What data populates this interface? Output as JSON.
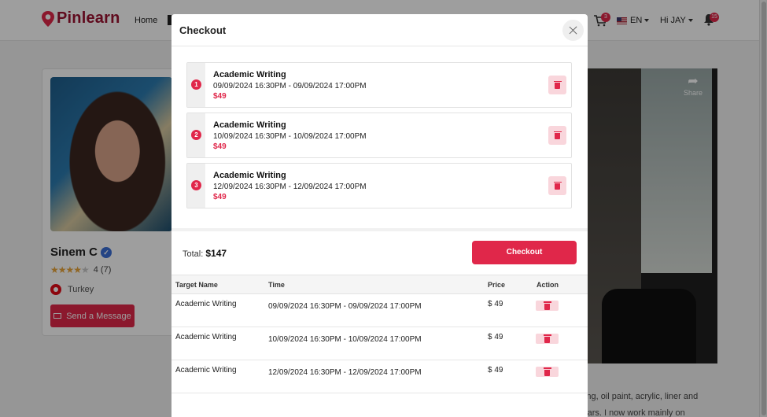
{
  "header": {
    "logo_text": "Pinlearn",
    "nav_home": "Home",
    "cart_count": "3",
    "language": "EN",
    "greeting": "Hi JAY",
    "notification_count": "15"
  },
  "profile": {
    "name": "Sinem C",
    "rating": "4",
    "rating_count": "(7)",
    "country": "Turkey",
    "send_message_label": "Send a Message"
  },
  "video": {
    "share_label": "Share"
  },
  "bio": {
    "line1": "wing, oil paint, acrylic, liner and",
    "line2": "years. I now work mainly on"
  },
  "modal": {
    "title": "Checkout",
    "items": [
      {
        "num": "1",
        "title": "Academic Writing",
        "time": "09/09/2024 16:30PM - 09/09/2024 17:00PM",
        "price": "$49"
      },
      {
        "num": "2",
        "title": "Academic Writing",
        "time": "10/09/2024 16:30PM - 10/09/2024 17:00PM",
        "price": "$49"
      },
      {
        "num": "3",
        "title": "Academic Writing",
        "time": "12/09/2024 16:30PM - 12/09/2024 17:00PM",
        "price": "$49"
      }
    ],
    "total_label": "Total:",
    "total_value": "$147",
    "checkout_label": "Checkout",
    "table": {
      "headers": [
        "Target Name",
        "Time",
        "Price",
        "Action"
      ],
      "rows": [
        {
          "name": "Academic Writing",
          "time": "09/09/2024 16:30PM - 09/09/2024 17:00PM",
          "price": "$ 49"
        },
        {
          "name": "Academic Writing",
          "time": "10/09/2024 16:30PM - 10/09/2024 17:00PM",
          "price": "$ 49"
        },
        {
          "name": "Academic Writing",
          "time": "12/09/2024 16:30PM - 12/09/2024 17:00PM",
          "price": "$ 49"
        }
      ]
    }
  },
  "colors": {
    "brand": "#e0274a",
    "logo": "#9b1231",
    "delete_bg": "#f9d6dc"
  }
}
